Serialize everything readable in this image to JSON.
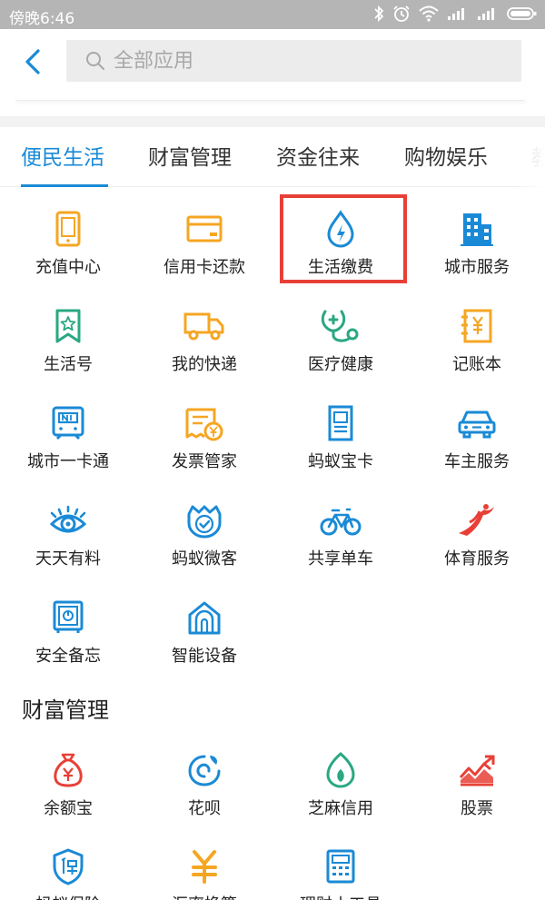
{
  "status_bar": {
    "time": "傍晚6:46"
  },
  "search": {
    "placeholder": "全部应用"
  },
  "tabs": [
    {
      "label": "便民生活"
    },
    {
      "label": "财富管理"
    },
    {
      "label": "资金往来"
    },
    {
      "label": "购物娱乐"
    },
    {
      "label": "教"
    }
  ],
  "life_services": [
    {
      "label": "充值中心",
      "icon": "phone-icon"
    },
    {
      "label": "信用卡还款",
      "icon": "credit-card-icon"
    },
    {
      "label": "生活缴费",
      "icon": "water-drop-icon"
    },
    {
      "label": "城市服务",
      "icon": "city-building-icon"
    },
    {
      "label": "生活号",
      "icon": "bookmark-star-icon"
    },
    {
      "label": "我的快递",
      "icon": "truck-icon"
    },
    {
      "label": "医疗健康",
      "icon": "stethoscope-icon"
    },
    {
      "label": "记账本",
      "icon": "ledger-icon"
    },
    {
      "label": "城市一卡通",
      "icon": "transit-card-icon"
    },
    {
      "label": "发票管家",
      "icon": "invoice-icon"
    },
    {
      "label": "蚂蚁宝卡",
      "icon": "sim-card-icon"
    },
    {
      "label": "车主服务",
      "icon": "car-icon"
    },
    {
      "label": "天天有料",
      "icon": "eye-icon"
    },
    {
      "label": "蚂蚁微客",
      "icon": "shield-check-icon"
    },
    {
      "label": "共享单车",
      "icon": "bicycle-icon"
    },
    {
      "label": "体育服务",
      "icon": "sports-icon"
    },
    {
      "label": "安全备忘",
      "icon": "safe-icon"
    },
    {
      "label": "智能设备",
      "icon": "smart-home-icon"
    }
  ],
  "wealth_section": {
    "title": "财富管理",
    "items": [
      {
        "label": "余额宝",
        "icon": "money-bag-icon"
      },
      {
        "label": "花呗",
        "icon": "huabei-icon"
      },
      {
        "label": "芝麻信用",
        "icon": "sesame-icon"
      },
      {
        "label": "股票",
        "icon": "stock-chart-icon"
      },
      {
        "label": "蚂蚁保险",
        "icon": "insurance-shield-icon"
      },
      {
        "label": "汇率换算",
        "icon": "yen-exchange-icon"
      },
      {
        "label": "理财小工具",
        "icon": "calculator-icon"
      }
    ]
  },
  "colors": {
    "accent": "#1a8ad6",
    "orange": "#f5a623",
    "red": "#e84037",
    "green": "#29a882"
  }
}
